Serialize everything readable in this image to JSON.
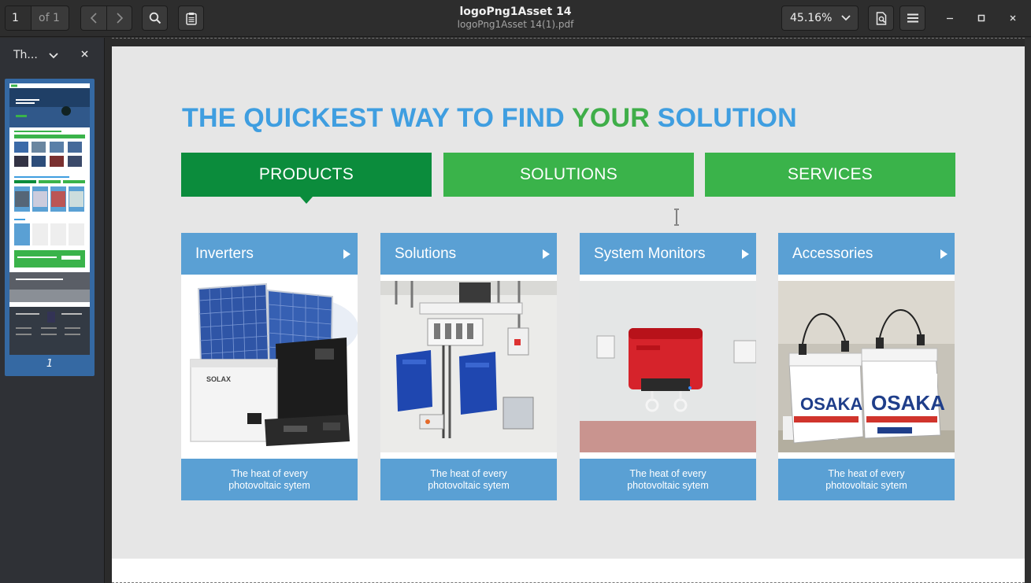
{
  "toolbar": {
    "page_current": "1",
    "page_of": "of 1",
    "title": "logoPng1Asset 14",
    "filename": "logoPng1Asset 14(1).pdf",
    "zoom": "45.16%"
  },
  "sidebar": {
    "selector_label": "Th...",
    "thumbnail_page_number": "1"
  },
  "document": {
    "headline_part1": "THE QUICKEST WAY TO FIND ",
    "headline_part2": "YOUR",
    "headline_part3": " SOLUTION",
    "tabs": [
      "PRODUCTS",
      "SOLUTIONS",
      "SERVICES"
    ],
    "cards": [
      {
        "title": "Inverters",
        "caption": "The heat of every photovoltaic sytem"
      },
      {
        "title": "Solutions",
        "caption": "The heat of every photovoltaic sytem"
      },
      {
        "title": "System Monitors",
        "caption": "The heat of every photovoltaic sytem"
      },
      {
        "title": "Accessories",
        "caption": "The heat of every photovoltaic sytem"
      }
    ],
    "inverter_brand": "SOLAX",
    "battery_brand": "OSAKA"
  },
  "colors": {
    "headline_blue": "#3f9ee0",
    "headline_green": "#3fae49",
    "tab_active": "#0b8c3c",
    "tab_inactive": "#3ab34a",
    "card_blue": "#5aa0d4",
    "sidebar_selected": "#3569a3"
  }
}
